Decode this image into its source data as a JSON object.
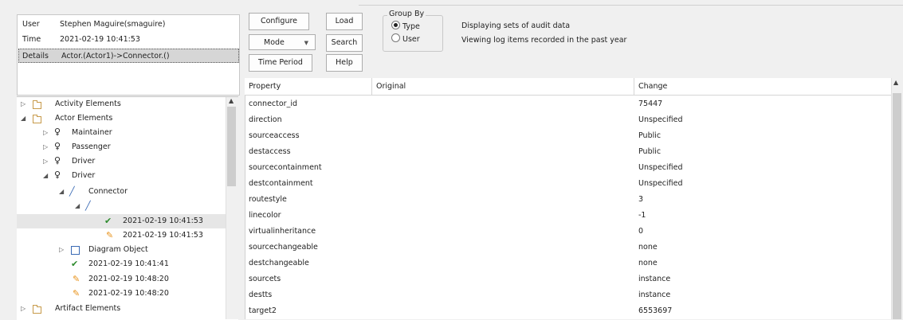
{
  "info": {
    "user_label": "User",
    "user_value": "Stephen Maguire(smaguire)",
    "time_label": "Time",
    "time_value": "2021-02-19 10:41:53",
    "details_label": "Details",
    "details_value": "Actor.(Actor1)->Connector.()"
  },
  "buttons": {
    "configure": "Configure",
    "load": "Load",
    "mode": "Mode",
    "search": "Search",
    "time_period": "Time Period",
    "help": "Help"
  },
  "group_by": {
    "title": "Group By",
    "type": "Type",
    "user": "User",
    "selected": "Type"
  },
  "messages": {
    "line1": "Displaying sets of audit data",
    "line2": "Viewing log items recorded in the past year"
  },
  "tree": {
    "items": [
      {
        "label": "Activity Elements"
      },
      {
        "label": "Actor Elements"
      },
      {
        "label": "Maintainer"
      },
      {
        "label": "Passenger"
      },
      {
        "label": "Driver"
      },
      {
        "label": "Driver"
      },
      {
        "label": "Connector"
      },
      {
        "label": ""
      },
      {
        "label": "2021-02-19 10:41:53"
      },
      {
        "label": "2021-02-19 10:41:53"
      },
      {
        "label": "Diagram Object"
      },
      {
        "label": "2021-02-19 10:41:41"
      },
      {
        "label": "2021-02-19 10:48:20"
      },
      {
        "label": "2021-02-19 10:48:20"
      },
      {
        "label": "Artifact Elements"
      }
    ]
  },
  "grid": {
    "headers": [
      "Property",
      "Original",
      "Change"
    ],
    "rows": [
      {
        "property": "connector_id",
        "original": "",
        "change": "75447"
      },
      {
        "property": "direction",
        "original": "",
        "change": "Unspecified"
      },
      {
        "property": "sourceaccess",
        "original": "",
        "change": "Public"
      },
      {
        "property": "destaccess",
        "original": "",
        "change": "Public"
      },
      {
        "property": "sourcecontainment",
        "original": "",
        "change": "Unspecified"
      },
      {
        "property": "destcontainment",
        "original": "",
        "change": "Unspecified"
      },
      {
        "property": "routestyle",
        "original": "",
        "change": "3"
      },
      {
        "property": "linecolor",
        "original": "",
        "change": "-1"
      },
      {
        "property": "virtualinheritance",
        "original": "",
        "change": "0"
      },
      {
        "property": "sourcechangeable",
        "original": "",
        "change": "none"
      },
      {
        "property": "destchangeable",
        "original": "",
        "change": "none"
      },
      {
        "property": "sourcets",
        "original": "",
        "change": "instance"
      },
      {
        "property": "destts",
        "original": "",
        "change": "instance"
      },
      {
        "property": "target2",
        "original": "",
        "change": "6553697"
      }
    ]
  },
  "colors": {
    "check": "#2e8b2e",
    "pencil": "#e8921a",
    "connector": "#3a6ab4",
    "selection": "#d6d6d6"
  }
}
